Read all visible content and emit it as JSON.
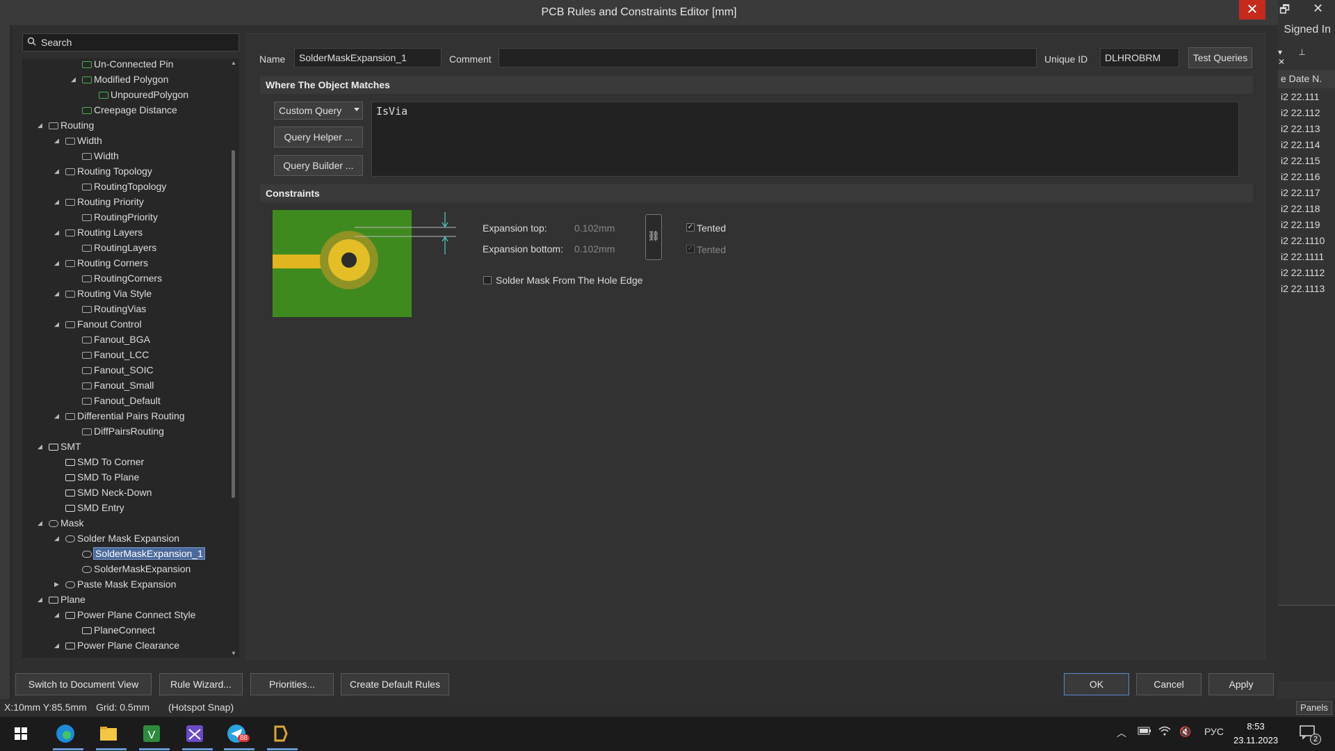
{
  "window": {
    "title": "PCB Rules and Constraints Editor [mm]",
    "close_glyph": "✕",
    "restore_glyph": "🗗",
    "outer_close_glyph": "✕"
  },
  "right_panel": {
    "signed_in": "Signed In",
    "header": "e Date  N.",
    "rows": [
      "i2 22.111",
      "i2 22.112",
      "i2 22.113",
      "i2 22.114",
      "i2 22.115",
      "i2 22.116",
      "i2 22.117",
      "i2 22.118",
      "i2 22.119",
      "i2 22.1110",
      "i2 22.1111",
      "i2 22.1112",
      "i2 22.1113"
    ],
    "pin_glyphs": "▾ ⊥ ✕"
  },
  "search": {
    "placeholder": "Search"
  },
  "tree": {
    "nodes": [
      {
        "label": "Un-Connected Pin"
      },
      {
        "label": "Modified Polygon"
      },
      {
        "label": "UnpouredPolygon"
      },
      {
        "label": "Creepage Distance"
      },
      {
        "label": "Routing"
      },
      {
        "label": "Width"
      },
      {
        "label": "Width"
      },
      {
        "label": "Routing Topology"
      },
      {
        "label": "RoutingTopology"
      },
      {
        "label": "Routing Priority"
      },
      {
        "label": "RoutingPriority"
      },
      {
        "label": "Routing Layers"
      },
      {
        "label": "RoutingLayers"
      },
      {
        "label": "Routing Corners"
      },
      {
        "label": "RoutingCorners"
      },
      {
        "label": "Routing Via Style"
      },
      {
        "label": "RoutingVias"
      },
      {
        "label": "Fanout Control"
      },
      {
        "label": "Fanout_BGA"
      },
      {
        "label": "Fanout_LCC"
      },
      {
        "label": "Fanout_SOIC"
      },
      {
        "label": "Fanout_Small"
      },
      {
        "label": "Fanout_Default"
      },
      {
        "label": "Differential Pairs Routing"
      },
      {
        "label": "DiffPairsRouting"
      },
      {
        "label": "SMT"
      },
      {
        "label": "SMD To Corner"
      },
      {
        "label": "SMD To Plane"
      },
      {
        "label": "SMD Neck-Down"
      },
      {
        "label": "SMD Entry"
      },
      {
        "label": "Mask"
      },
      {
        "label": "Solder Mask Expansion"
      },
      {
        "label": "SolderMaskExpansion_1"
      },
      {
        "label": "SolderMaskExpansion"
      },
      {
        "label": "Paste Mask Expansion"
      },
      {
        "label": "Plane"
      },
      {
        "label": "Power Plane Connect Style"
      },
      {
        "label": "PlaneConnect"
      },
      {
        "label": "Power Plane Clearance"
      }
    ],
    "selected": "SolderMaskExpansion_1"
  },
  "rule": {
    "name_label": "Name",
    "name_value": "SolderMaskExpansion_1",
    "comment_label": "Comment",
    "comment_value": "",
    "uid_label": "Unique ID",
    "uid_value": "DLHROBRM",
    "test_queries": "Test Queries"
  },
  "where": {
    "section_title": "Where The Object Matches",
    "query_type": "Custom Query",
    "query_helper": "Query Helper ...",
    "query_builder": "Query Builder ...",
    "query_text": "IsVia"
  },
  "constraints": {
    "section_title": "Constraints",
    "expansion_top_label": "Expansion top:",
    "expansion_top_value": "0.102mm",
    "expansion_bottom_label": "Expansion bottom:",
    "expansion_bottom_value": "0.102mm",
    "tented_label": "Tented",
    "tented_top_checked": true,
    "tented_bottom_checked": true,
    "from_hole_label": "Solder Mask From The Hole Edge",
    "from_hole_checked": false,
    "link_glyph": "⛓",
    "check_glyph": "✓"
  },
  "footer": {
    "switch_doc": "Switch to Document View",
    "rule_wizard": "Rule Wizard...",
    "priorities": "Priorities...",
    "create_default": "Create Default Rules",
    "ok": "OK",
    "cancel": "Cancel",
    "apply": "Apply"
  },
  "status": {
    "coords": "X:10mm Y:85.5mm",
    "grid": "Grid: 0.5mm",
    "snap": "(Hotspot Snap)",
    "panels": "Panels"
  },
  "taskbar": {
    "lang": "РУС",
    "time": "8:53",
    "date": "23.11.2023",
    "telegram_badge": "88",
    "notif_count": "2",
    "tray_chevron": "︿",
    "volume_glyph": "🔇"
  }
}
